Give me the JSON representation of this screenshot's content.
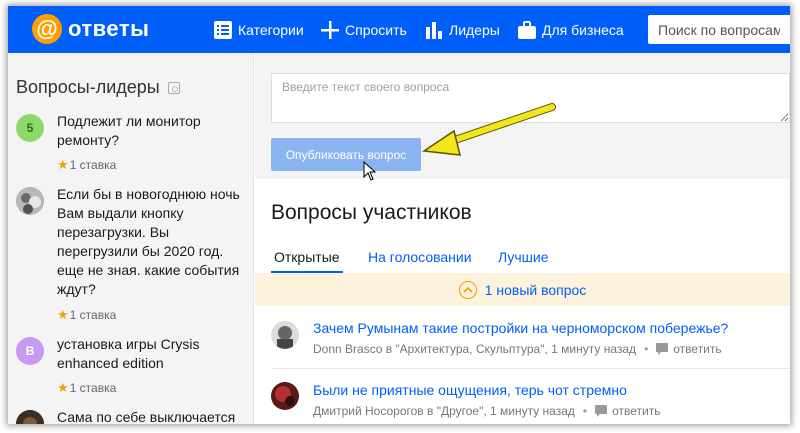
{
  "header": {
    "logo_symbol": "@",
    "logo_text": "ответы",
    "nav": {
      "categories": "Категории",
      "ask": "Спросить",
      "leaders": "Лидеры",
      "business": "Для бизнеса"
    },
    "search_placeholder": "Поиск по вопросам"
  },
  "sidebar": {
    "title": "Вопросы-лидеры",
    "items": [
      {
        "avatar_letter": "5",
        "text": "Подлежит ли монитор ремонту?",
        "stake": "1 ставка"
      },
      {
        "avatar_letter": "",
        "text": "Если бы в новогоднюю ночь Вам выдали кнопку перезагрузки. Вы перегрузили бы 2020 год. еще не зная. какие события ждут?",
        "stake": "1 ставка"
      },
      {
        "avatar_letter": "B",
        "text": "установка игры Crysis enhanced edition",
        "stake": "1 ставка"
      },
      {
        "avatar_letter": "",
        "text": "Сама по себе выключается",
        "stake": ""
      }
    ]
  },
  "ask": {
    "placeholder": "Введите текст своего вопроса",
    "publish_label": "Опубликовать вопрос"
  },
  "questions": {
    "title": "Вопросы участников",
    "tabs": {
      "open": "Открытые",
      "voting": "На голосовании",
      "best": "Лучшие"
    },
    "new_notice": "1 новый вопрос",
    "reply_label": "ответить",
    "items": [
      {
        "title": "Зачем Румынам такие постройки на черноморском побережье?",
        "meta": "Donn Brasco в \"Архитектура, Скульптура\", 1 минуту назад"
      },
      {
        "title": "Были не приятные ощущения, терь чот стремно",
        "meta": "Дмитрий Носорогов в \"Другое\", 1 минуту назад"
      }
    ]
  },
  "colors": {
    "brand_blue": "#005ff9",
    "logo_orange": "#ff9e00",
    "star": "#f2a100",
    "arrow_yellow": "#f4e61c"
  }
}
